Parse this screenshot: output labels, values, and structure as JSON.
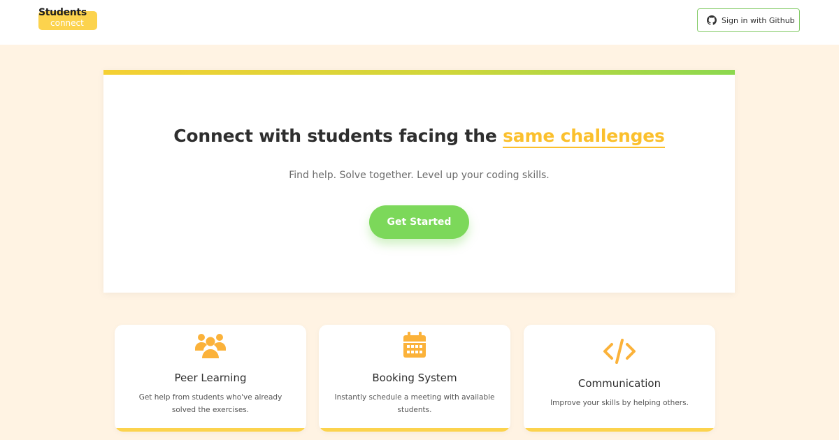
{
  "brand": {
    "top": "Students",
    "bottom": "connect"
  },
  "nav": {
    "signin_label": "Sign in with Github",
    "signin_icon": "github-icon"
  },
  "hero": {
    "title_main": "Connect with students facing the",
    "title_highlight": "same challenges",
    "subtitle": "Find help. Solve together. Level up your coding skills.",
    "cta_label": "Get Started"
  },
  "features": [
    {
      "icon": "users-icon",
      "title": "Peer Learning",
      "description": "Get help from students who've already solved the exercises."
    },
    {
      "icon": "calendar-icon",
      "title": "Booking System",
      "description": "Instantly schedule a meeting with available students."
    },
    {
      "icon": "code-icon",
      "title": "Communication",
      "description": "Improve your skills by helping others."
    }
  ],
  "colors": {
    "accent_yellow": "#fbc02d",
    "accent_green": "#7cd85a",
    "background": "#fff3e3"
  }
}
